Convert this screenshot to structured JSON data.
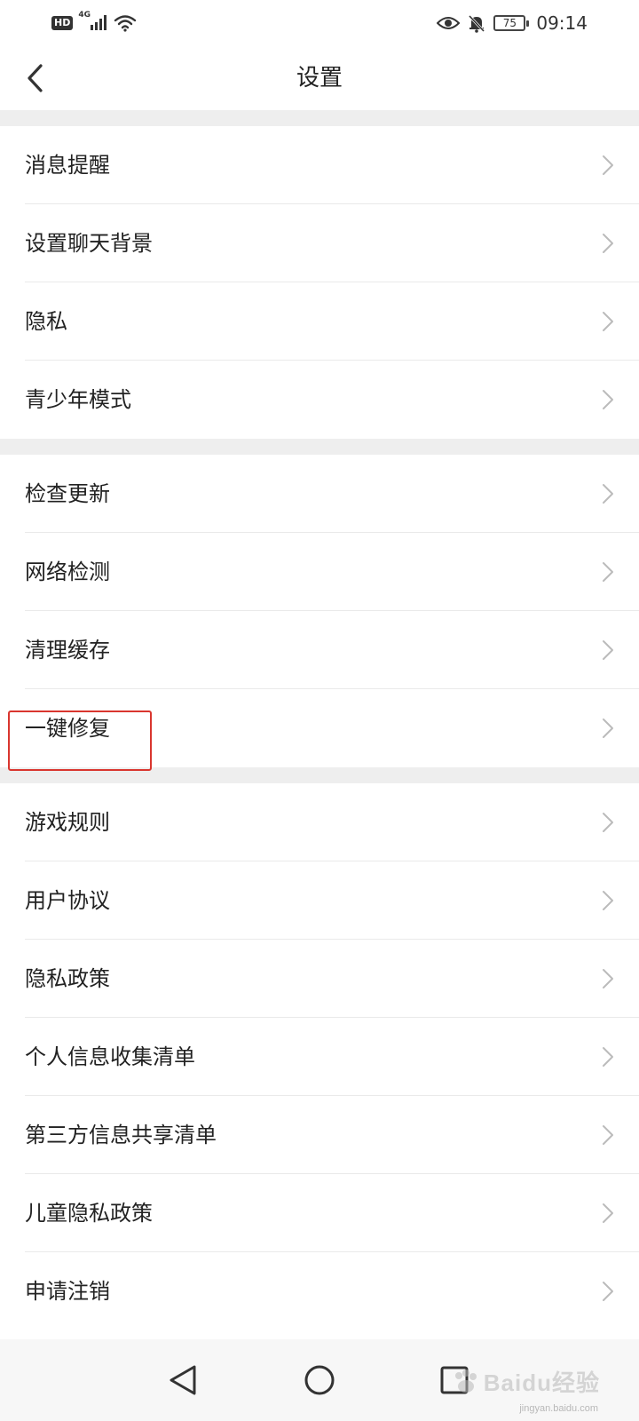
{
  "status_bar": {
    "hd_badge": "HD",
    "network": "4G",
    "battery": "75",
    "time": "09:14",
    "icons": [
      "signal-icon",
      "wifi-icon",
      "eye-icon",
      "bell-off-icon",
      "battery-icon"
    ]
  },
  "header": {
    "title": "设置",
    "back_icon": "chevron-left-icon"
  },
  "groups": [
    {
      "items": [
        {
          "label": "消息提醒"
        },
        {
          "label": "设置聊天背景"
        },
        {
          "label": "隐私"
        },
        {
          "label": "青少年模式"
        }
      ]
    },
    {
      "items": [
        {
          "label": "检查更新"
        },
        {
          "label": "网络检测"
        },
        {
          "label": "清理缓存"
        },
        {
          "label": "一键修复",
          "highlighted": true
        }
      ]
    },
    {
      "items": [
        {
          "label": "游戏规则"
        },
        {
          "label": "用户协议"
        },
        {
          "label": "隐私政策"
        },
        {
          "label": "个人信息收集清单"
        },
        {
          "label": "第三方信息共享清单"
        },
        {
          "label": "儿童隐私政策"
        },
        {
          "label": "申请注销"
        }
      ]
    }
  ],
  "nav_bar": {
    "icons": [
      "back-triangle-icon",
      "home-circle-icon",
      "recents-square-icon"
    ]
  },
  "watermark": {
    "text": "Baidu经验",
    "subtext": "jingyan.baidu.com"
  },
  "colors": {
    "highlight_border": "#d9362e",
    "section_gap": "#eeeeee",
    "chevron": "#bbbbbb"
  }
}
